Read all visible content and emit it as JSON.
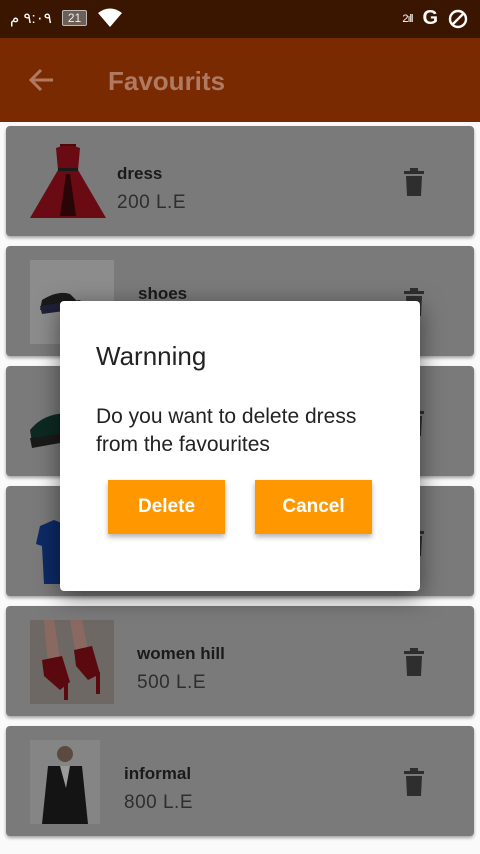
{
  "status_bar": {
    "time": "٩:٠٩ م",
    "notification_badge": "21",
    "signal_text": "2ıll",
    "network": "G"
  },
  "app_bar": {
    "title": "Favourits"
  },
  "favourites": [
    {
      "name": "dress",
      "price": "200  L.E",
      "image": "red-dress"
    },
    {
      "name": "shoes",
      "price": "",
      "image": "black-sneakers"
    },
    {
      "name": "",
      "price": "",
      "image": "green-sneaker"
    },
    {
      "name": "",
      "price": "",
      "image": "blue-shirt"
    },
    {
      "name": "women hill",
      "price": "500  L.E",
      "image": "red-high-heels"
    },
    {
      "name": "informal",
      "price": "800  L.E",
      "image": "man-in-blazer"
    }
  ],
  "dialog": {
    "title": "Warnning",
    "message": "Do you want to delete dress  from the favourites",
    "delete_label": "Delete",
    "cancel_label": "Cancel"
  },
  "colors": {
    "status_bar": "#3a1600",
    "app_bar": "#7a2a00",
    "button": "#ff9800",
    "card_dimmed": "#7a7a7a"
  }
}
